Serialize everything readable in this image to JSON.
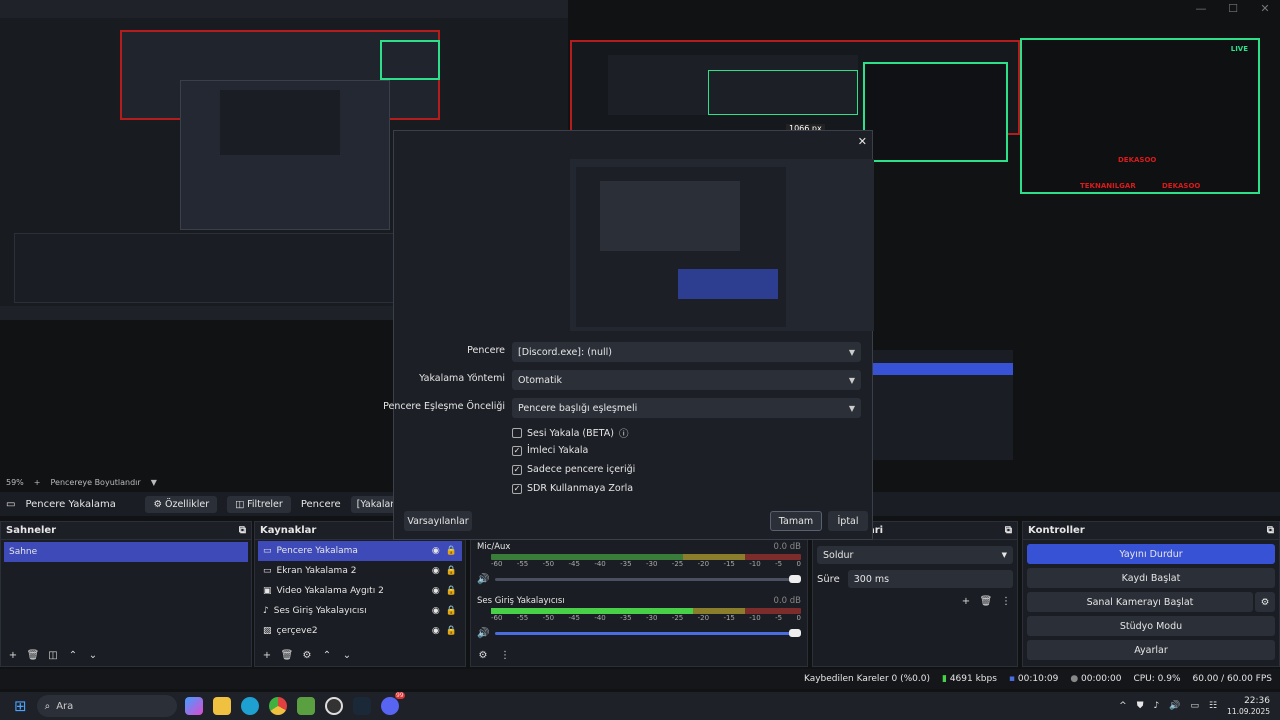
{
  "window": {
    "controls": [
      "—",
      "☐",
      "✕"
    ]
  },
  "overlay_frame": {
    "live_badge": "LIVE",
    "name_1": "DEKASOO",
    "name_2": "TEKNANILGAR",
    "name_3": "DEKASOO",
    "px_label": "1066 px"
  },
  "canvas_toolbar": {
    "zoom": "59%",
    "add": "+",
    "resize_label": "Pencereye Boyutlandır"
  },
  "source_toolbar": {
    "source_name": "Pencere Yakalama",
    "properties_label": "Özellikler",
    "filters_label": "Filtreler",
    "window_label": "Pencere",
    "window_value": "[Yakalanacak bir p"
  },
  "scenes": {
    "title": "Sahneler",
    "items": [
      "Sahne"
    ]
  },
  "sources": {
    "title": "Kaynaklar",
    "items": [
      {
        "label": "Pencere Yakalama",
        "icon": "window-icon"
      },
      {
        "label": "Ekran Yakalama 2",
        "icon": "monitor-icon"
      },
      {
        "label": "Video Yakalama Aygıtı 2",
        "icon": "camera-icon"
      },
      {
        "label": "Ses Giriş Yakalayıcısı",
        "icon": "mic-icon"
      },
      {
        "label": "çerçeve2",
        "icon": "image-icon"
      }
    ]
  },
  "mixer": {
    "channels": [
      {
        "name": "Mic/Aux",
        "db": "0.0 dB",
        "level": 0
      },
      {
        "name": "Ses Giriş Yakalayıcısı",
        "db": "0.0 dB",
        "level": 0.65
      }
    ],
    "ticks": [
      "-60",
      "-55",
      "-50",
      "-45",
      "-40",
      "-35",
      "-30",
      "-25",
      "-20",
      "-15",
      "-10",
      "-5",
      "0"
    ]
  },
  "transitions": {
    "title_fragment": "ari",
    "type": "Soldur",
    "duration_label": "Süre",
    "duration_value": "300 ms"
  },
  "controls": {
    "title": "Kontroller",
    "buttons": [
      "Yayını Durdur",
      "Kaydı Başlat",
      "Sanal Kamerayı Başlat",
      "Stüdyo Modu",
      "Ayarlar"
    ]
  },
  "status": {
    "dropped": "Kaybedilen Kareler 0 (%0.0)",
    "bitrate": "4691 kbps",
    "live_time": "00:10:09",
    "rec_time": "00:00:00",
    "cpu": "CPU: 0.9%",
    "fps": "60.00 / 60.00 FPS"
  },
  "dialog": {
    "close": "✕",
    "fields": [
      {
        "label": "Pencere",
        "value": "[Discord.exe]: (null)"
      },
      {
        "label": "Yakalama Yöntemi",
        "value": "Otomatik"
      },
      {
        "label": "Pencere Eşleşme Önceliği",
        "value": "Pencere başlığı eşleşmeli"
      }
    ],
    "checks": [
      {
        "label": "Sesi Yakala (BETA)",
        "checked": false
      },
      {
        "label": "İmleci Yakala",
        "checked": true
      },
      {
        "label": "Sadece pencere içeriği",
        "checked": true
      },
      {
        "label": "SDR Kullanmaya Zorla",
        "checked": true
      }
    ],
    "defaults_label": "Varsayılanlar",
    "ok_label": "Tamam",
    "cancel_label": "İptal"
  },
  "taskbar": {
    "search_placeholder": "Ara",
    "time": "22:36",
    "date": "11.09.2025",
    "tray_arrow": "^",
    "badge": "99"
  },
  "colors": {
    "accent": "#3d4ab8",
    "overlay_green": "#2de08a",
    "overlay_red": "#d81b1b"
  }
}
